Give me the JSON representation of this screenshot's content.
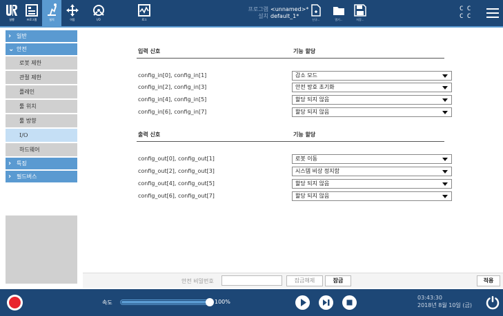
{
  "header": {
    "nav": [
      {
        "name": "run",
        "caption": "실행"
      },
      {
        "name": "program",
        "caption": "프로그램"
      },
      {
        "name": "installation",
        "caption": "설치"
      },
      {
        "name": "move",
        "caption": "이동"
      },
      {
        "name": "io",
        "caption": "I/O"
      },
      {
        "name": "log",
        "caption": "로그"
      }
    ],
    "program_label": "프로그램",
    "program_value": "<unnamed>*",
    "installation_label": "설치",
    "installation_value": "default_1*",
    "file_buttons": [
      {
        "name": "new",
        "caption": "신규..."
      },
      {
        "name": "open",
        "caption": "열기..."
      },
      {
        "name": "save",
        "caption": "저장..."
      }
    ],
    "cc_line1": "C C",
    "cc_line2": "C C"
  },
  "sidebar": {
    "categories": [
      {
        "label": "일반",
        "expanded": false
      },
      {
        "label": "안전",
        "expanded": true
      },
      {
        "label": "특징",
        "expanded": false
      },
      {
        "label": "필드버스",
        "expanded": false
      }
    ],
    "safety_items": [
      {
        "label": "로봇 제한"
      },
      {
        "label": "관절 제한"
      },
      {
        "label": "플레인"
      },
      {
        "label": "툴 위치"
      },
      {
        "label": "툴 방향"
      },
      {
        "label": "I/O",
        "active": true
      },
      {
        "label": "하드웨어"
      }
    ]
  },
  "main": {
    "input_section": {
      "header": "입력 신호",
      "function_header": "기능 할당",
      "rows": [
        {
          "signal": "config_in[0], config_in[1]",
          "value": "감소 모드"
        },
        {
          "signal": "config_in[2], config_in[3]",
          "value": "안전 방호 초기화"
        },
        {
          "signal": "config_in[4], config_in[5]",
          "value": "할당 되지 않음"
        },
        {
          "signal": "config_in[6], config_in[7]",
          "value": "할당 되지 않음"
        }
      ]
    },
    "output_section": {
      "header": "출력 신호",
      "function_header": "기능 할당",
      "rows": [
        {
          "signal": "config_out[0], config_out[1]",
          "value": "로봇 이동"
        },
        {
          "signal": "config_out[2], config_out[3]",
          "value": "시스템 비상 정지함"
        },
        {
          "signal": "config_out[4], config_out[5]",
          "value": "할당 되지 않음"
        },
        {
          "signal": "config_out[6], config_out[7]",
          "value": "할당 되지 않음"
        }
      ]
    }
  },
  "actions": {
    "password_label": "안전 비밀번호",
    "password_value": "",
    "unlock": "잠금해제",
    "lock": "잠금",
    "apply": "적용"
  },
  "footer": {
    "speed_label": "속도",
    "speed_value": "100%",
    "speed_fraction": 1.0,
    "time": "03:43:30",
    "date": "2018년 8월 10일 (금)"
  },
  "colors": {
    "header_bg": "#1d4776",
    "accent": "#5a9ad1",
    "sidebar_item": "#d0d0d0",
    "sidebar_active": "#c5dff5",
    "record_red": "#e8242e"
  }
}
